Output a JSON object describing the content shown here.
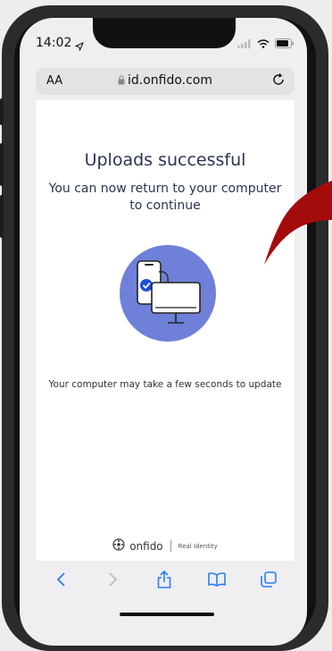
{
  "status": {
    "time": "14:02"
  },
  "browser": {
    "text_size": "AA",
    "url": "id.onfido.com"
  },
  "page": {
    "title": "Uploads successful",
    "subtitle": "You can now return to your computer to continue",
    "note": "Your computer may take a few seconds to update"
  },
  "footer": {
    "brand": "onfido",
    "tagline": "Real Identity"
  },
  "colors": {
    "text": "#2a3551",
    "illustration": "#6f80d8",
    "accent": "#1d4ed8",
    "toolbar_icon": "#2a7cf7"
  },
  "toolbar": {
    "icons": [
      "back-icon",
      "forward-icon",
      "share-icon",
      "bookmarks-icon",
      "tabs-icon"
    ]
  }
}
